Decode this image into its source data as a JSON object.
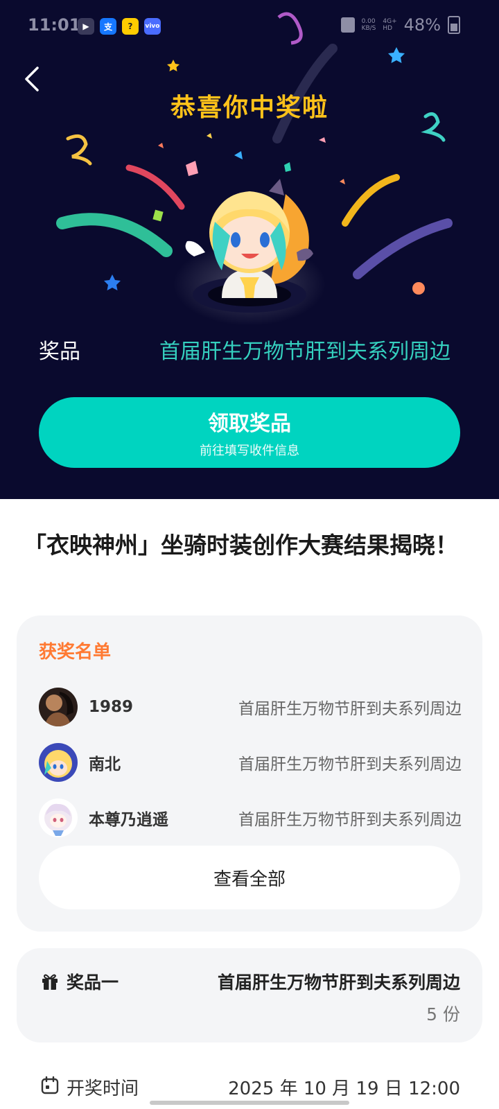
{
  "status_bar": {
    "time": "11:01",
    "app_icons": [
      "▶",
      "支",
      "?",
      "vivo"
    ],
    "network": "0.00\nKB/S",
    "network_type": "4G+\nHD",
    "battery": "48%"
  },
  "hero": {
    "title": "恭喜你中奖啦",
    "prize_label": "奖品",
    "prize_value": "首届肝生万物节肝到夫系列周边",
    "claim_button": {
      "title": "领取奖品",
      "subtitle": "前往填写收件信息"
    }
  },
  "article": {
    "title": "「衣映神州」坐骑时装创作大赛结果揭晓！"
  },
  "winners": {
    "heading": "获奖名单",
    "rows": [
      {
        "name": "1989",
        "prize": "首届肝生万物节肝到夫系列周边"
      },
      {
        "name": "南北",
        "prize": "首届肝生万物节肝到夫系列周边"
      },
      {
        "name": "本尊乃逍遥",
        "prize": "首届肝生万物节肝到夫系列周边"
      }
    ],
    "view_all": "查看全部"
  },
  "prize_info": {
    "label": "奖品一",
    "name": "首届肝生万物节肝到夫系列周边",
    "quantity": "5 份"
  },
  "draw": {
    "label": "开奖时间",
    "value": "2025 年 10 月 19 日 12:00"
  },
  "colors": {
    "hero_bg": "#0a0a2e",
    "title_gold": "#ffc21a",
    "teal": "#00d4c0",
    "prize_teal_text": "#35d0bf",
    "orange_heading": "#ff7a33",
    "card_bg": "#f4f5f7"
  },
  "icons": [
    "back-icon",
    "gift-icon",
    "calendar-icon",
    "battery-icon",
    "signal-icon"
  ]
}
